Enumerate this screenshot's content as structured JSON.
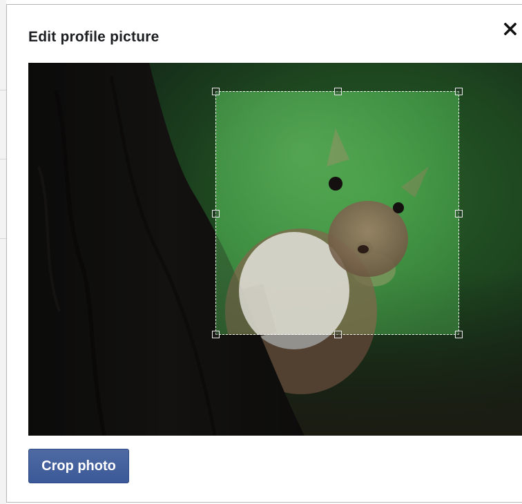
{
  "dialog": {
    "title": "Edit profile picture",
    "close_icon": "close-icon",
    "primary_color": "#3b5998"
  },
  "photo": {
    "subject": "squirrel peeking from behind tree trunk",
    "crop_region": "square"
  },
  "actions": {
    "crop_label": "Crop photo"
  }
}
